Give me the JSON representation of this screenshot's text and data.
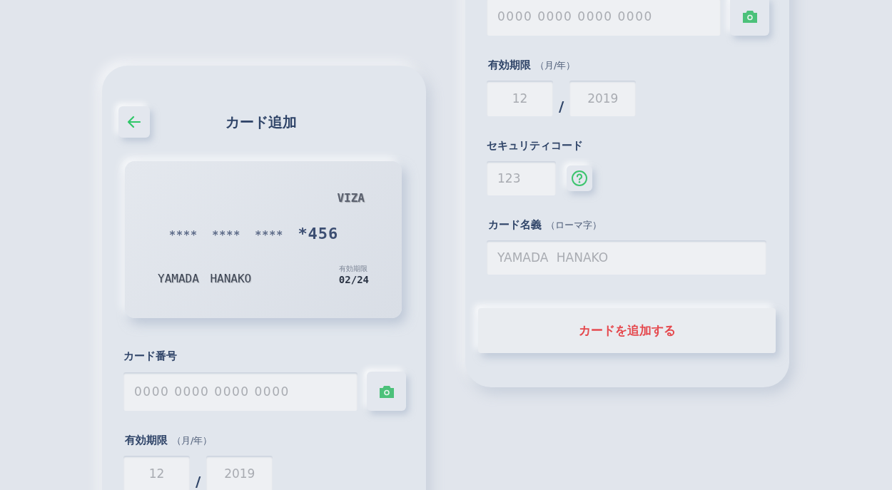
{
  "left_screen": {
    "header": {
      "title": "カード追加"
    },
    "card_preview": {
      "brand": "VIZA",
      "number_groups": [
        "****",
        "****",
        "****",
        "*456"
      ],
      "holder": "YAMADA HANAKO",
      "expiry_caption": "有効期限",
      "expiry": "02/24"
    },
    "card_number": {
      "label": "カード番号",
      "placeholder": "0000 0000 0000 0000"
    },
    "expiry": {
      "label": "有効期限",
      "hint": "（月/年）",
      "month_placeholder": "12",
      "separator": "/",
      "year_placeholder": "2019"
    }
  },
  "right_screen": {
    "card_number": {
      "placeholder": "0000 0000 0000 0000"
    },
    "expiry": {
      "label": "有効期限",
      "hint": "（月/年）",
      "month_placeholder": "12",
      "separator": "/",
      "year_placeholder": "2019"
    },
    "security_code": {
      "label": "セキュリティコード",
      "placeholder": "123"
    },
    "card_holder": {
      "label": "カード名義",
      "hint": "（ローマ字）",
      "placeholder": "YAMADA HANAKO"
    },
    "submit_button": {
      "label": "カードを追加する"
    }
  }
}
